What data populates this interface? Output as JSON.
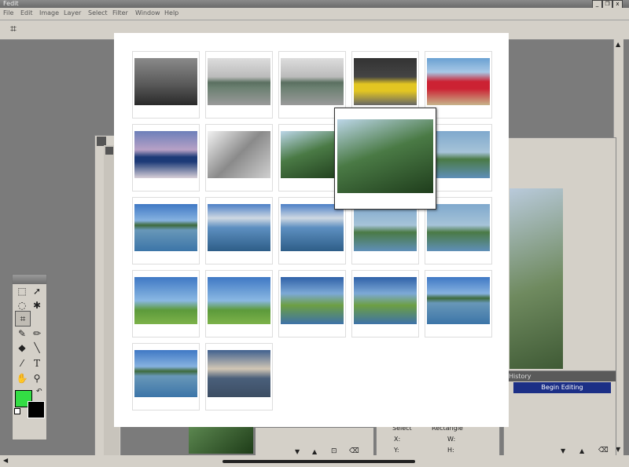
{
  "app": {
    "title": "Fedit"
  },
  "menu": [
    "File",
    "Edit",
    "Image",
    "Layer",
    "Select",
    "Filter",
    "Window",
    "Help"
  ],
  "window_controls": {
    "minimize": "_",
    "restore": "❐",
    "close": "x"
  },
  "history": {
    "title": "History",
    "items": [
      "Begin Editing"
    ]
  },
  "info": {
    "x_label": "X:",
    "y_label": "Y:",
    "w_label": "W:",
    "h_label": "H:",
    "tool_label": "Select",
    "shape_label": "Rectangle"
  },
  "colors": {
    "foreground": "#33dd44",
    "background": "#000000",
    "selection": "#1c2f86"
  },
  "gallery": {
    "thumbnails": [
      {
        "icon": "car-silver-photo"
      },
      {
        "icon": "car-green-photo"
      },
      {
        "icon": "car-green-photo-2"
      },
      {
        "icon": "car-yellow-photo"
      },
      {
        "icon": "car-red-photo"
      },
      {
        "icon": "car-blue-photo"
      },
      {
        "icon": "building-photo"
      },
      {
        "icon": "jungle-photo"
      },
      {
        "icon": "jungle-photo-2"
      },
      {
        "icon": "jungle-coast-photo"
      },
      {
        "icon": "sea-island-photo"
      },
      {
        "icon": "sea-clouds-photo"
      },
      {
        "icon": "sea-storm-cloud-photo"
      },
      {
        "icon": "sea-tree-photo"
      },
      {
        "icon": "sea-tree-photo-2"
      },
      {
        "icon": "palm-beach-photo"
      },
      {
        "icon": "palm-hill-photo"
      },
      {
        "icon": "green-hills-photo"
      },
      {
        "icon": "green-hills-photo-2"
      },
      {
        "icon": "bay-clouds-photo"
      },
      {
        "icon": "bay-photo"
      },
      {
        "icon": "sunset-photo"
      }
    ],
    "preview": {
      "icon": "jungle-preview-photo"
    }
  }
}
